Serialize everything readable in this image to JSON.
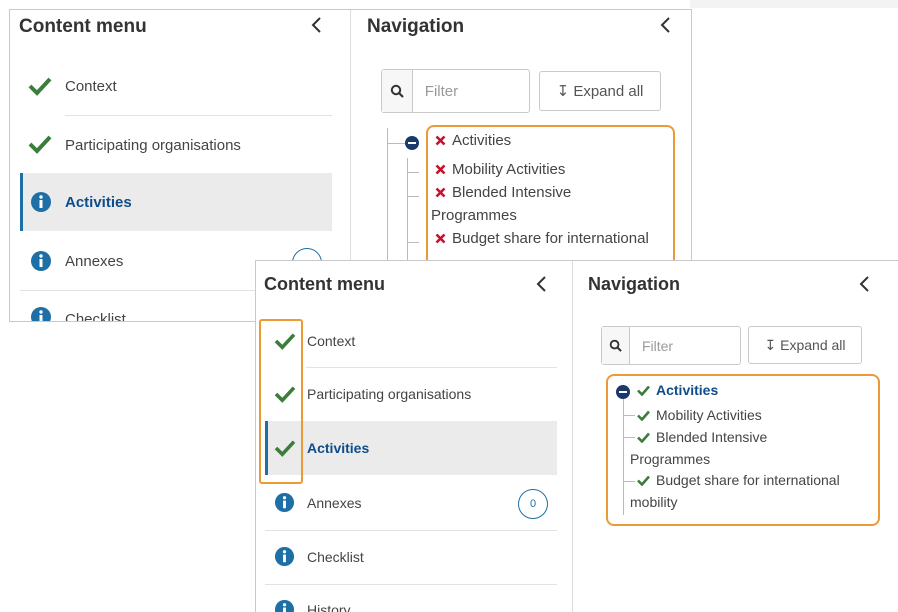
{
  "back": {
    "content_menu": {
      "title": "Content menu",
      "items": [
        {
          "label": "Context",
          "status": "check"
        },
        {
          "label": "Participating organisations",
          "status": "check"
        },
        {
          "label": "Activities",
          "status": "info",
          "active": true
        },
        {
          "label": "Annexes",
          "status": "info"
        },
        {
          "label": "Checklist",
          "status": "info"
        }
      ]
    },
    "navigation": {
      "title": "Navigation",
      "filter_placeholder": "Filter",
      "expand_label": "↧ Expand all",
      "tree": {
        "root": "Activities",
        "children": [
          "Mobility Activities",
          "Blended Intensive",
          "Budget share for international"
        ],
        "wrap_1": "Programmes"
      },
      "node_status": "cross"
    }
  },
  "front": {
    "content_menu": {
      "title": "Content menu",
      "items": [
        {
          "label": "Context",
          "status": "check"
        },
        {
          "label": "Participating organisations",
          "status": "check"
        },
        {
          "label": "Activities",
          "status": "check",
          "active": true
        },
        {
          "label": "Annexes",
          "status": "info",
          "badge": "0"
        },
        {
          "label": "Checklist",
          "status": "info"
        },
        {
          "label": "History",
          "status": "info"
        }
      ]
    },
    "navigation": {
      "title": "Navigation",
      "filter_placeholder": "Filter",
      "expand_label": "↧ Expand all",
      "tree": {
        "root": "Activities",
        "children": [
          "Mobility Activities",
          "Blended Intensive",
          "Budget share for international"
        ],
        "wrap_1": "Programmes",
        "wrap_2": "mobility"
      },
      "node_status": "check"
    }
  },
  "colors": {
    "check_green": "#3c7d3a",
    "cross_red": "#c8102e",
    "info_blue": "#1d6fa5",
    "highlight_orange": "#ec9a35",
    "active_text": "#0e4d8a"
  },
  "icons": {
    "check": "check-icon",
    "info": "info-icon",
    "cross": "cross-icon",
    "chevron": "chevron-left-icon",
    "search": "search-icon",
    "collapse": "collapse-minus-icon"
  }
}
